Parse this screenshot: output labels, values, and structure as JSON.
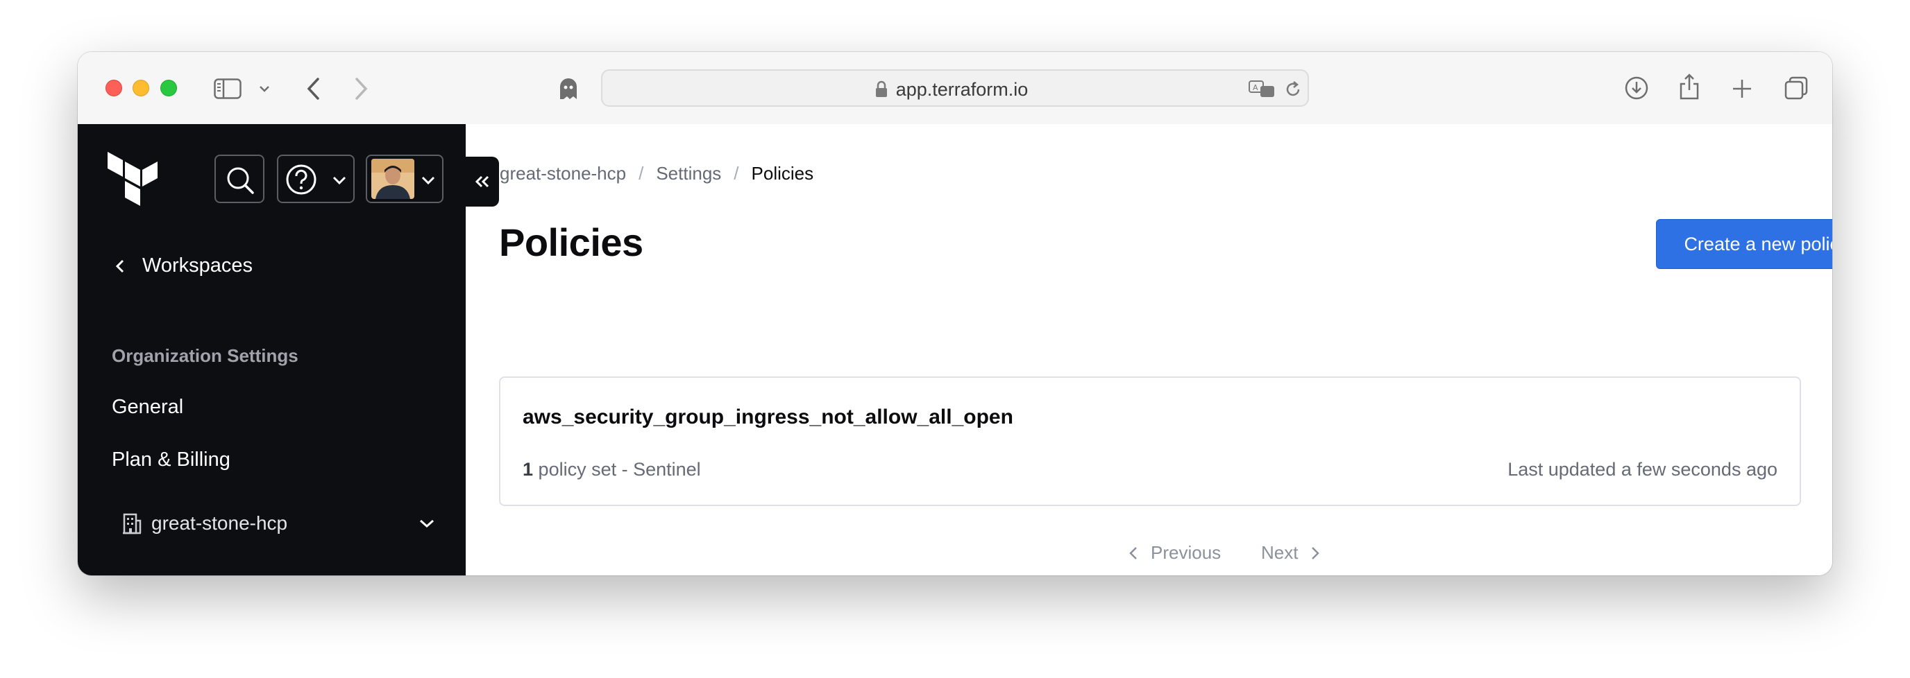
{
  "browser": {
    "url": "app.terraform.io"
  },
  "sidebar": {
    "back_label": "Workspaces",
    "section_title": "Organization Settings",
    "items": [
      {
        "label": "General"
      },
      {
        "label": "Plan & Billing"
      }
    ],
    "organization": "great-stone-hcp"
  },
  "main": {
    "breadcrumb": [
      "great-stone-hcp",
      "/",
      "Settings",
      "/",
      "Policies"
    ],
    "title": "Policies",
    "create_button": "Create a new policy",
    "policies": [
      {
        "name": "aws_security_group_ingress_not_allow_all_open",
        "count": "1",
        "meta_suffix": "policy set - Sentinel",
        "updated": "Last updated a few seconds ago"
      }
    ],
    "pagination": {
      "previous": "Previous",
      "next": "Next"
    }
  },
  "colors": {
    "sidebar_bg": "#0d0e12",
    "primary": "#2e71e5",
    "text": "#0c0c0e",
    "muted": "#656a76"
  },
  "icons": [
    "sidebar-toggle-icon",
    "chevron-down-icon",
    "back-icon",
    "forward-icon",
    "ghost-icon",
    "lock-icon",
    "translate-icon",
    "reload-icon",
    "download-icon",
    "share-icon",
    "new-tab-icon",
    "tabs-overview-icon",
    "terraform-logo",
    "search-icon",
    "help-icon",
    "chevron-left-icon",
    "collapse-icon",
    "building-icon",
    "chevron-right-icon"
  ]
}
